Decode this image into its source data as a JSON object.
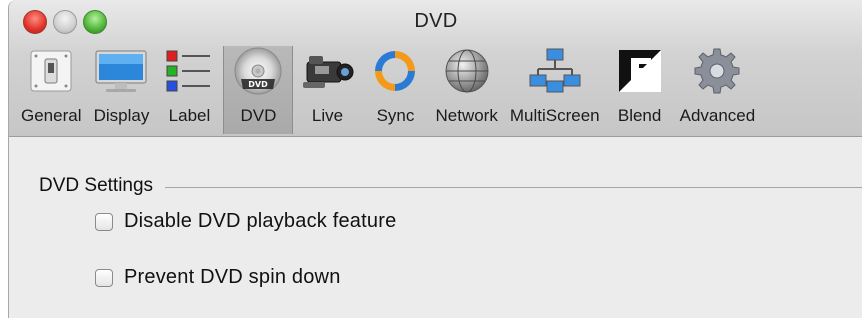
{
  "window": {
    "title": "DVD"
  },
  "toolbar": {
    "items": [
      {
        "label": "General",
        "icon": "switch-icon"
      },
      {
        "label": "Display",
        "icon": "monitor-icon"
      },
      {
        "label": "Label",
        "icon": "label-list-icon"
      },
      {
        "label": "DVD",
        "icon": "dvd-disc-icon",
        "selected": true
      },
      {
        "label": "Live",
        "icon": "video-camera-icon"
      },
      {
        "label": "Sync",
        "icon": "sync-arrows-icon"
      },
      {
        "label": "Network",
        "icon": "globe-icon"
      },
      {
        "label": "MultiScreen",
        "icon": "multiscreen-network-icon"
      },
      {
        "label": "Blend",
        "icon": "blend-icon"
      },
      {
        "label": "Advanced",
        "icon": "gear-icon"
      }
    ]
  },
  "dvd_settings": {
    "title": "DVD Settings",
    "options": [
      {
        "label": "Disable DVD playback feature",
        "checked": false
      },
      {
        "label": "Prevent DVD spin down",
        "checked": false
      }
    ]
  }
}
